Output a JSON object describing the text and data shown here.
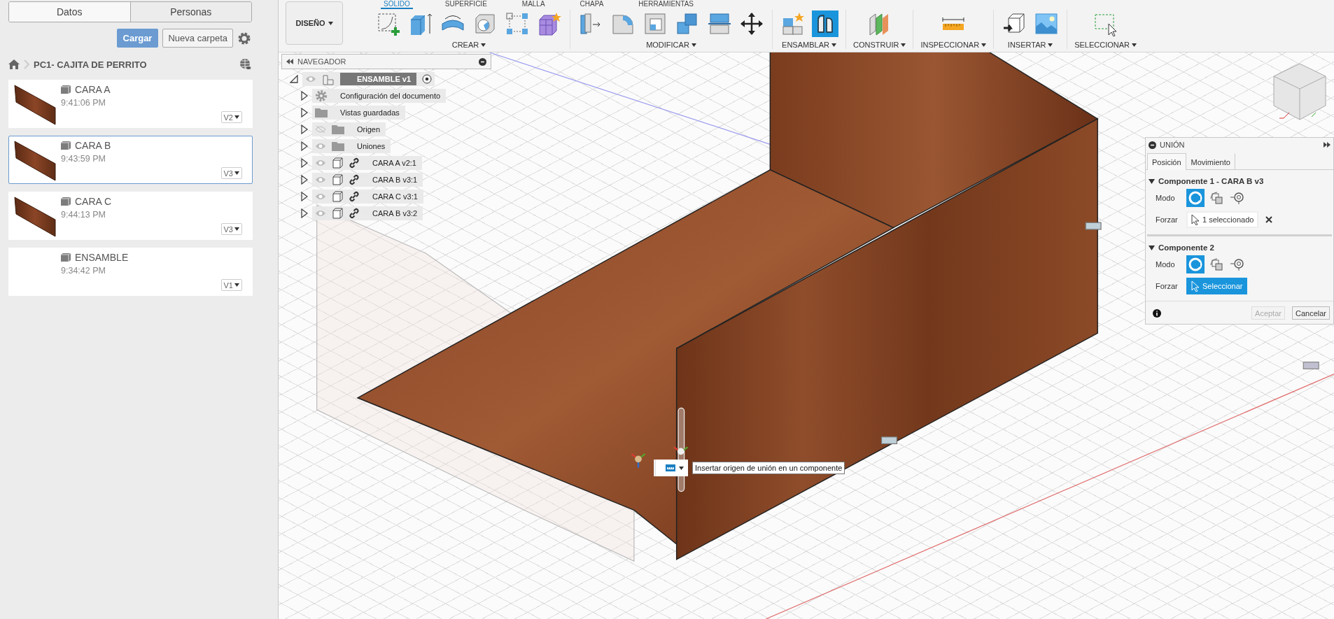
{
  "data_panel": {
    "tabs": [
      {
        "label": "Datos",
        "selected": true
      },
      {
        "label": "Personas",
        "selected": false
      }
    ],
    "upload_button": "Cargar",
    "new_folder_button": "Nueva carpeta",
    "breadcrumb": "PC1- CAJITA DE PERRITO",
    "files": [
      {
        "name": "CARA A",
        "time": "9:41:06 PM",
        "version": "V2",
        "selected": false,
        "thumbnail": true
      },
      {
        "name": "CARA B",
        "time": "9:43:59 PM",
        "version": "V3",
        "selected": true,
        "thumbnail": true
      },
      {
        "name": "CARA C",
        "time": "9:44:13 PM",
        "version": "V3",
        "selected": false,
        "thumbnail": true
      },
      {
        "name": "ENSAMBLE",
        "time": "9:34:42 PM",
        "version": "V1",
        "selected": false,
        "thumbnail": false
      }
    ]
  },
  "toolbar": {
    "workspace": "DISEÑO",
    "tabs": [
      {
        "label": "SÓLIDO",
        "selected": true
      },
      {
        "label": "SUPERFICIE",
        "selected": false
      },
      {
        "label": "MALLA",
        "selected": false
      },
      {
        "label": "CHAPA",
        "selected": false
      },
      {
        "label": "HERRAMIENTAS",
        "selected": false
      }
    ],
    "groups": [
      {
        "label": "CREAR",
        "tools": [
          {
            "active": false
          },
          {
            "active": false
          },
          {
            "active": false
          },
          {
            "active": false
          },
          {
            "active": false
          },
          {
            "active": false
          }
        ]
      },
      {
        "label": "MODIFICAR",
        "tools": [
          {
            "active": false
          },
          {
            "active": false
          },
          {
            "active": false
          },
          {
            "active": false
          },
          {
            "active": false
          },
          {
            "active": false
          }
        ]
      },
      {
        "label": "ENSAMBLAR",
        "tools": [
          {
            "active": false
          },
          {
            "active": true
          }
        ]
      },
      {
        "label": "CONSTRUIR",
        "tools": [
          {
            "active": false
          }
        ]
      },
      {
        "label": "INSPECCIONAR",
        "tools": [
          {
            "active": false
          }
        ]
      },
      {
        "label": "INSERTAR",
        "tools": [
          {
            "active": false
          },
          {
            "active": false
          }
        ]
      },
      {
        "label": "SELECCIONAR",
        "tools": [
          {
            "active": false
          }
        ]
      }
    ]
  },
  "navigator": {
    "title": "NAVEGADOR",
    "root": {
      "label": "ENSAMBLE v1",
      "expanded": true,
      "visible": true,
      "children": [
        {
          "label": "Configuración del documento",
          "kind": "settings",
          "expanded": false
        },
        {
          "label": "Vistas guardadas",
          "kind": "folder",
          "expanded": false
        },
        {
          "label": "Origen",
          "kind": "folder",
          "expanded": false,
          "visible": false
        },
        {
          "label": "Uniones",
          "kind": "folder",
          "expanded": false,
          "visible": true
        },
        {
          "label": "CARA A v2:1",
          "kind": "component",
          "expanded": false,
          "visible": true
        },
        {
          "label": "CARA B v3:1",
          "kind": "component",
          "expanded": false,
          "visible": true
        },
        {
          "label": "CARA C v3:1",
          "kind": "component",
          "expanded": false,
          "visible": true
        },
        {
          "label": "CARA B v3:2",
          "kind": "component",
          "expanded": false,
          "visible": true
        }
      ]
    }
  },
  "joint_panel": {
    "title": "UNIÓN",
    "tabs": [
      {
        "label": "Posición",
        "selected": true
      },
      {
        "label": "Movimiento",
        "selected": false
      }
    ],
    "sections": [
      {
        "title": "Componente 1 - CARA B v3",
        "expanded": true,
        "mode_label": "Modo",
        "modes": [
          {
            "selected": true
          },
          {
            "selected": false
          },
          {
            "selected": false
          }
        ],
        "snap_label": "Forzar",
        "snap": {
          "text": "1 seleccionado",
          "active": false,
          "clearable": true
        }
      },
      {
        "title": "Componente 2",
        "expanded": true,
        "mode_label": "Modo",
        "modes": [
          {
            "selected": true
          },
          {
            "selected": false
          },
          {
            "selected": false
          }
        ],
        "snap_label": "Forzar",
        "snap": {
          "text": "Seleccionar",
          "active": true,
          "clearable": false
        }
      }
    ],
    "ok_button": {
      "label": "Aceptar",
      "disabled": true
    },
    "cancel_button": "Cancelar"
  },
  "tooltip": "Insertar origen de unión en un componente"
}
